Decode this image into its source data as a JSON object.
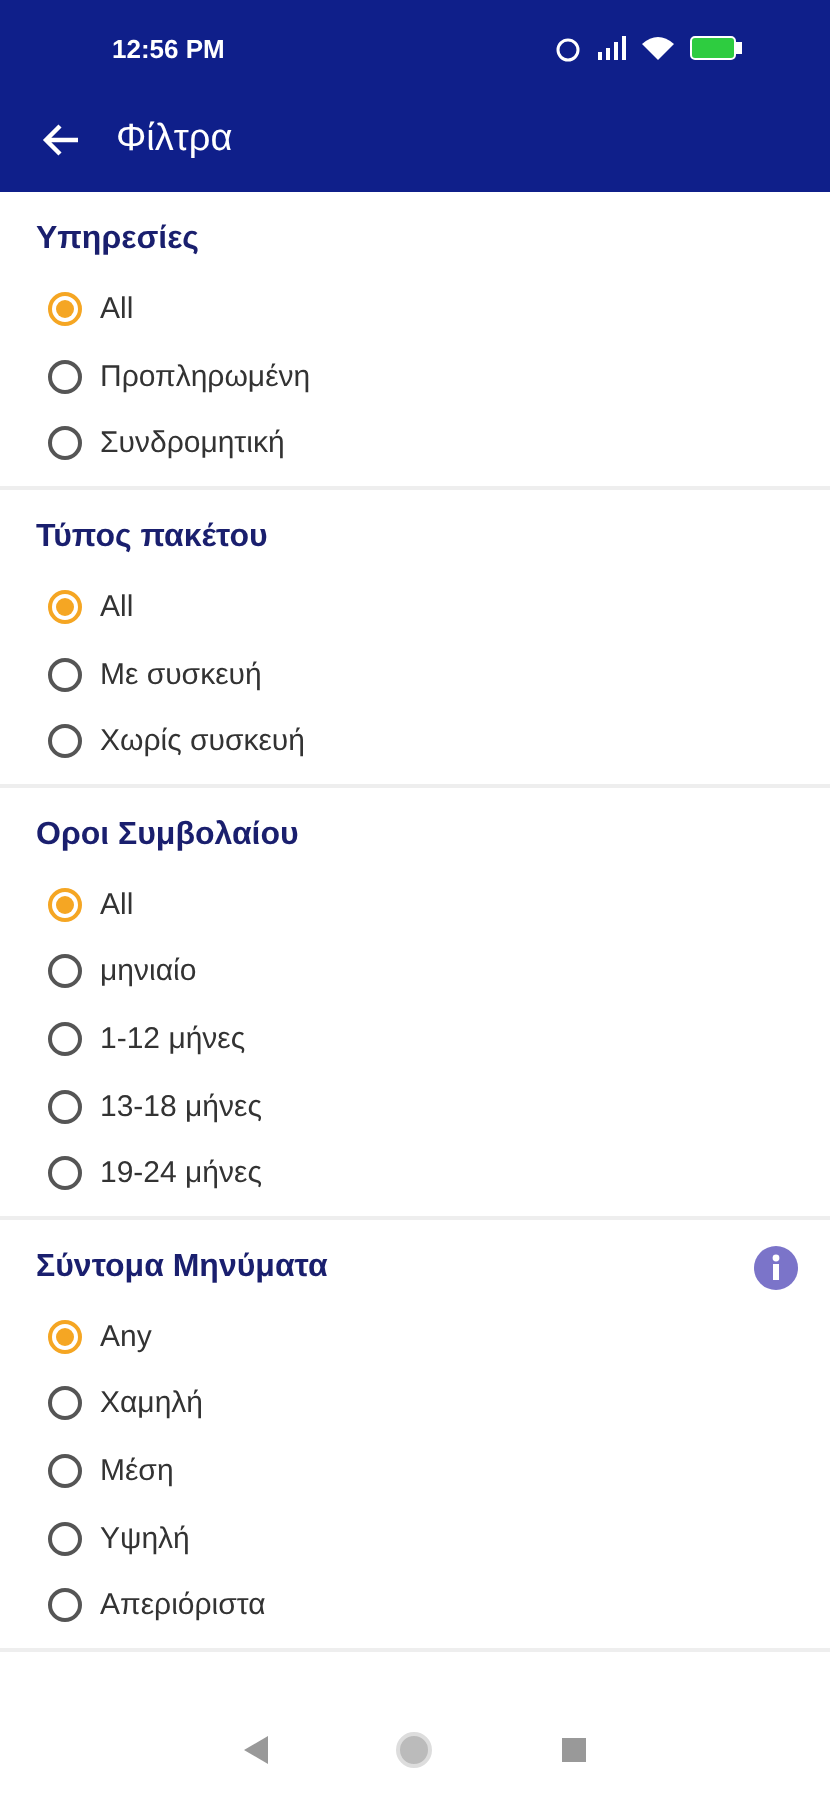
{
  "status_bar": {
    "time": "12:56 PM"
  },
  "app_bar": {
    "title": "Φίλτρα"
  },
  "sections": [
    {
      "title": "Υπηρεσίες",
      "info": false,
      "options": [
        {
          "label": "All",
          "selected": true
        },
        {
          "label": "Προπληρωμένη",
          "selected": false
        },
        {
          "label": "Συνδρομητική",
          "selected": false
        }
      ]
    },
    {
      "title": "Τύπος πακέτου",
      "info": false,
      "options": [
        {
          "label": "All",
          "selected": true
        },
        {
          "label": "Με συσκευή",
          "selected": false
        },
        {
          "label": "Χωρίς συσκευή",
          "selected": false
        }
      ]
    },
    {
      "title": "Οροι Συμβολαίου",
      "info": false,
      "options": [
        {
          "label": "All",
          "selected": true
        },
        {
          "label": "μηνιαίο",
          "selected": false
        },
        {
          "label": "1-12 μήνες",
          "selected": false
        },
        {
          "label": "13-18 μήνες",
          "selected": false
        },
        {
          "label": "19-24 μήνες",
          "selected": false
        }
      ]
    },
    {
      "title": "Σύντομα Μηνύματα",
      "info": true,
      "options": [
        {
          "label": "Any",
          "selected": true
        },
        {
          "label": "Χαμηλή",
          "selected": false
        },
        {
          "label": "Μέση",
          "selected": false
        },
        {
          "label": "Υψηλή",
          "selected": false
        },
        {
          "label": "Απεριόριστα",
          "selected": false
        }
      ]
    }
  ]
}
